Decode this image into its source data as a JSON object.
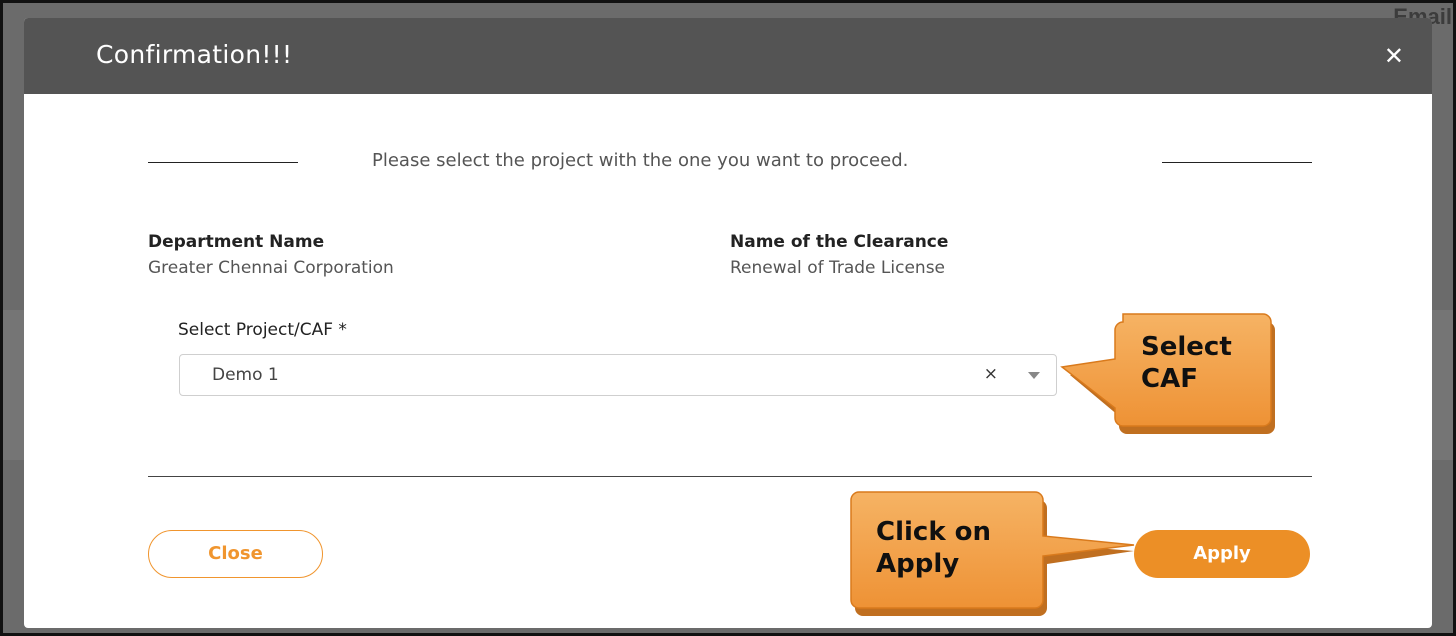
{
  "background": {
    "partial_text": "Email"
  },
  "modal": {
    "title": "Confirmation!!!",
    "close_icon": "close-icon",
    "instruction": "Please select the project with the one you want to proceed.",
    "department_label": "Department Name",
    "department_value": "Greater Chennai Corporation",
    "clearance_label": "Name of the Clearance",
    "clearance_value": "Renewal of Trade License",
    "select_label": "Select Project/CAF *",
    "select_value": "Demo 1",
    "select_clear": "×",
    "close_button": "Close",
    "apply_button": "Apply"
  },
  "callouts": {
    "select_caf_line1": "Select",
    "select_caf_line2": "CAF",
    "apply_line1": "Click on",
    "apply_line2": "Apply"
  },
  "colors": {
    "header": "#545454",
    "accent": "#ec8f26",
    "callout_fill": "#f2a24a"
  }
}
